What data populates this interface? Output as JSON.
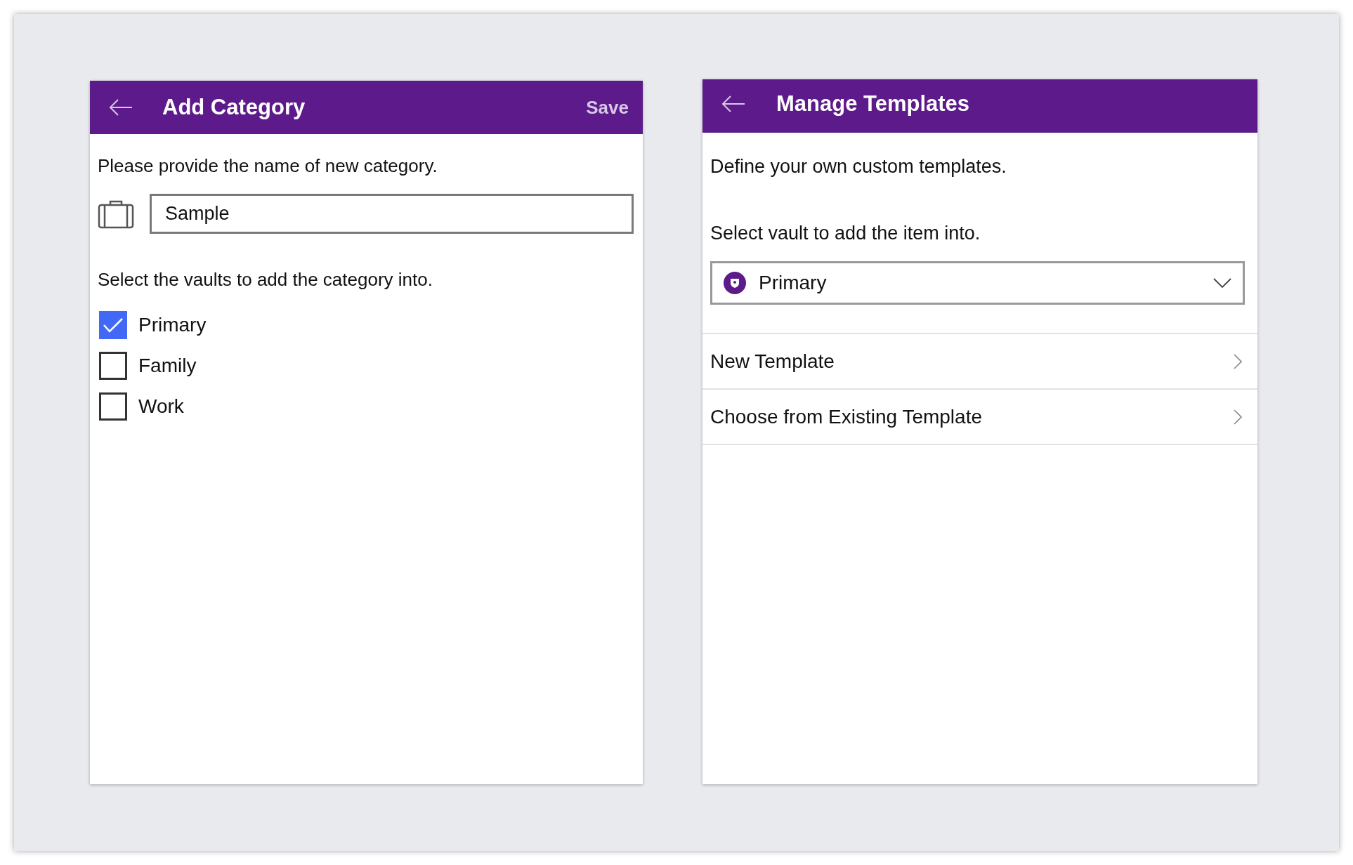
{
  "add_category": {
    "title": "Add Category",
    "save": "Save",
    "prompt": "Please provide the name of new category.",
    "name_field": {
      "value": "Sample"
    },
    "vaults_label": "Select the vaults to add the category into.",
    "vaults": [
      {
        "label": "Primary",
        "checked": true
      },
      {
        "label": "Family",
        "checked": false
      },
      {
        "label": "Work",
        "checked": false
      }
    ]
  },
  "manage_templates": {
    "title": "Manage Templates",
    "intro": "Define your own custom templates.",
    "vault_label": "Select vault to add the item into.",
    "vault_select": {
      "value": "Primary"
    },
    "items": [
      {
        "label": "New Template"
      },
      {
        "label": "Choose from Existing Template"
      }
    ]
  }
}
